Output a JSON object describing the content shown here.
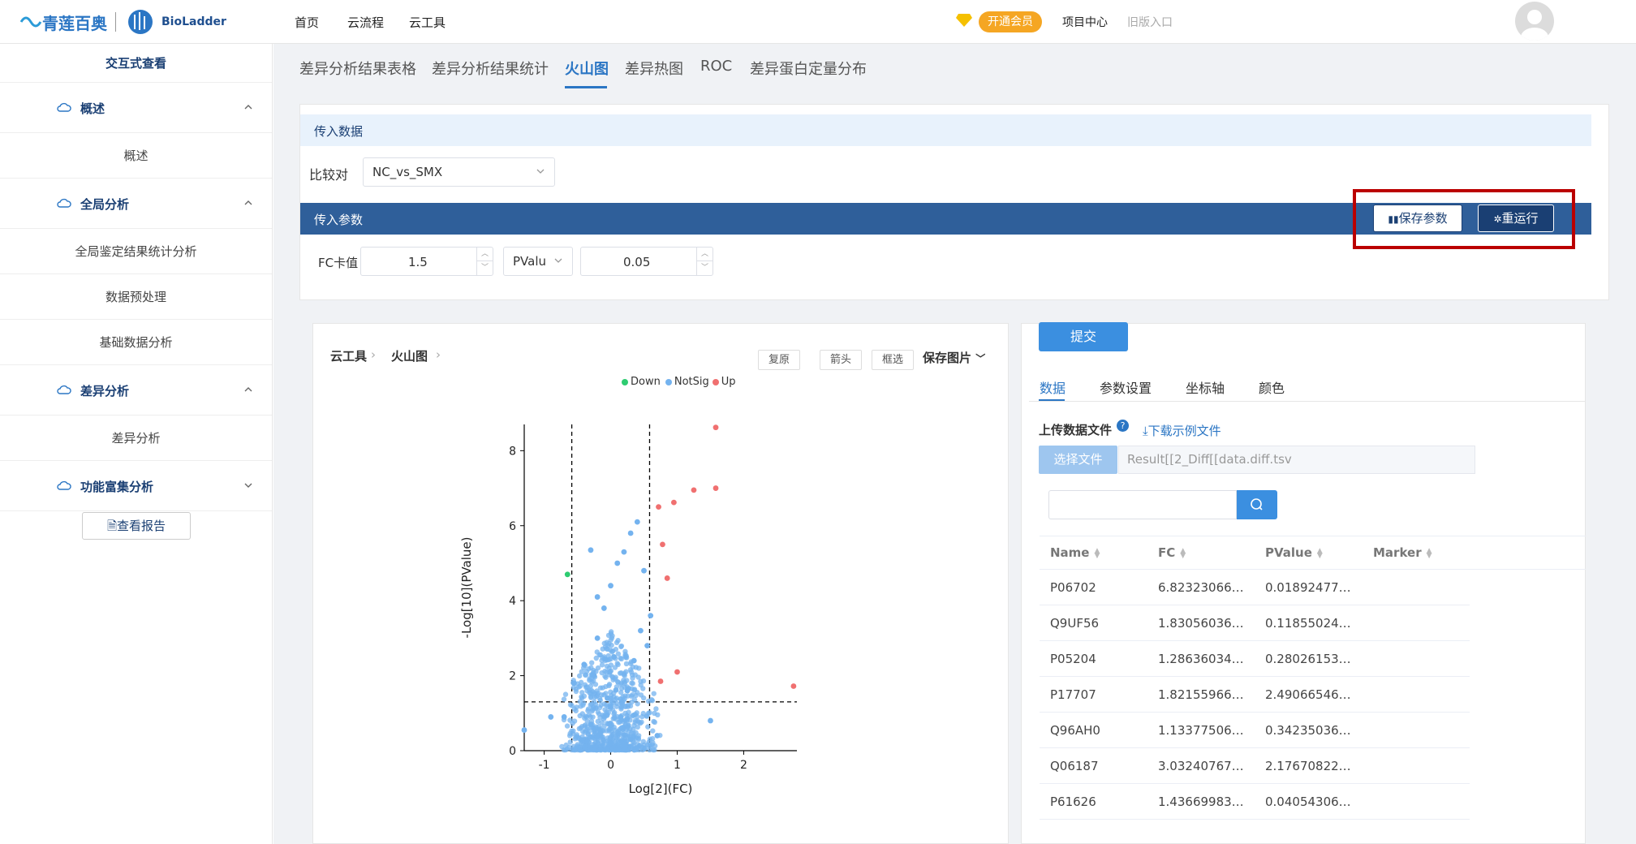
{
  "header": {
    "logo_text": "青莲百奥",
    "brand": "BioLadder",
    "nav": [
      "首页",
      "云流程",
      "云工具"
    ],
    "vip_label": "开通会员",
    "project_center": "项目中心",
    "old_entry": "旧版入口"
  },
  "sidebar": {
    "title": "交互式查看",
    "groups": [
      {
        "label": "概述",
        "items": [
          "概述"
        ]
      },
      {
        "label": "全局分析",
        "items": [
          "全局鉴定结果统计分析",
          "数据预处理",
          "基础数据分析"
        ]
      },
      {
        "label": "差异分析",
        "items": [
          "差异分析"
        ]
      },
      {
        "label": "功能富集分析",
        "items": []
      }
    ],
    "report_button": "查看报告"
  },
  "tabs": [
    "差异分析结果表格",
    "差异分析结果统计",
    "火山图",
    "差异热图",
    "ROC",
    "差异蛋白定量分布"
  ],
  "active_tab": "火山图",
  "input_data": {
    "header": "传入数据",
    "compare_label": "比较对",
    "compare_value": "NC_vs_SMX"
  },
  "params": {
    "header": "传入参数",
    "save_label": "保存参数",
    "rerun_label": "重运行",
    "fc_label": "FC卡值",
    "fc_value": "1.5",
    "p_type": "PValu",
    "p_value": "0.05"
  },
  "plot_panel": {
    "breadcrumb": [
      "云工具",
      "火山图"
    ],
    "buttons": [
      "复原",
      "箭头",
      "框选"
    ],
    "save_pic": "保存图片"
  },
  "chart_data": {
    "type": "scatter",
    "xlabel": "Log[2](FC)",
    "ylabel": "-Log[10](PValue)",
    "xlim": [
      -1.3,
      2.8
    ],
    "ylim": [
      0,
      8.7
    ],
    "xticks": [
      -1,
      0,
      1,
      2
    ],
    "yticks": [
      0,
      2,
      4,
      6,
      8
    ],
    "thresholds": {
      "x": [
        -0.585,
        0.585
      ],
      "y": 1.301
    },
    "legend": [
      "Down",
      "NotSig",
      "Up"
    ],
    "colors": {
      "Down": "#2ecc71",
      "NotSig": "#74b3ef",
      "Up": "#f07070"
    },
    "series": [
      {
        "name": "Down",
        "points": [
          [
            -0.65,
            4.7
          ]
        ]
      },
      {
        "name": "Up",
        "points": [
          [
            1.58,
            8.62
          ],
          [
            1.58,
            7.0
          ],
          [
            1.25,
            6.95
          ],
          [
            0.95,
            6.62
          ],
          [
            0.72,
            6.5
          ],
          [
            0.78,
            5.5
          ],
          [
            0.85,
            4.6
          ],
          [
            1.0,
            2.1
          ],
          [
            0.75,
            1.85
          ],
          [
            2.75,
            1.72
          ]
        ]
      },
      {
        "name": "NotSig",
        "points": [
          [
            -1.3,
            0.55
          ],
          [
            -0.9,
            0.9
          ],
          [
            -0.55,
            1.8
          ],
          [
            -0.4,
            2.3
          ],
          [
            -0.2,
            3.0
          ],
          [
            -0.1,
            3.8
          ],
          [
            0.0,
            4.4
          ],
          [
            0.1,
            5.0
          ],
          [
            0.3,
            5.8
          ],
          [
            0.4,
            6.1
          ],
          [
            0.2,
            5.3
          ],
          [
            -0.2,
            4.1
          ],
          [
            0.5,
            4.8
          ],
          [
            0.45,
            3.2
          ],
          [
            0.55,
            2.8
          ],
          [
            0.35,
            2.4
          ],
          [
            -0.3,
            5.35
          ],
          [
            0.6,
            3.6
          ],
          [
            1.5,
            0.8
          ],
          [
            -0.7,
            0.9
          ],
          [
            0.7,
            0.4
          ],
          [
            0.05,
            2.5
          ],
          [
            -0.05,
            1.4
          ],
          [
            0.15,
            0.9
          ],
          [
            -0.15,
            0.5
          ],
          [
            0.25,
            1.6
          ],
          [
            -0.25,
            2.0
          ],
          [
            0.3,
            0.3
          ],
          [
            -0.3,
            0.7
          ],
          [
            0.0,
            0.2
          ]
        ]
      }
    ]
  },
  "right_panel": {
    "submit": "提交",
    "tabs": [
      "数据",
      "参数设置",
      "坐标轴",
      "颜色"
    ],
    "upload_label": "上传数据文件",
    "download_example": "下载示例文件",
    "choose_file": "选择文件",
    "file_name": "Result[[2_Diff[[data.diff.tsv",
    "columns": [
      "Name",
      "FC",
      "PValue",
      "Marker"
    ],
    "rows": [
      [
        "P06702",
        "6.82323066…",
        "0.01892477…",
        ""
      ],
      [
        "Q9UF56",
        "1.83056036…",
        "0.11855024…",
        ""
      ],
      [
        "P05204",
        "1.28636034…",
        "0.28026153…",
        ""
      ],
      [
        "P17707",
        "1.82155966…",
        "2.49066546…",
        ""
      ],
      [
        "Q96AH0",
        "1.13377506…",
        "0.34235036…",
        ""
      ],
      [
        "Q06187",
        "3.03240767…",
        "2.17670822…",
        ""
      ],
      [
        "P61626",
        "1.43669983…",
        "0.04054306…",
        ""
      ]
    ]
  }
}
